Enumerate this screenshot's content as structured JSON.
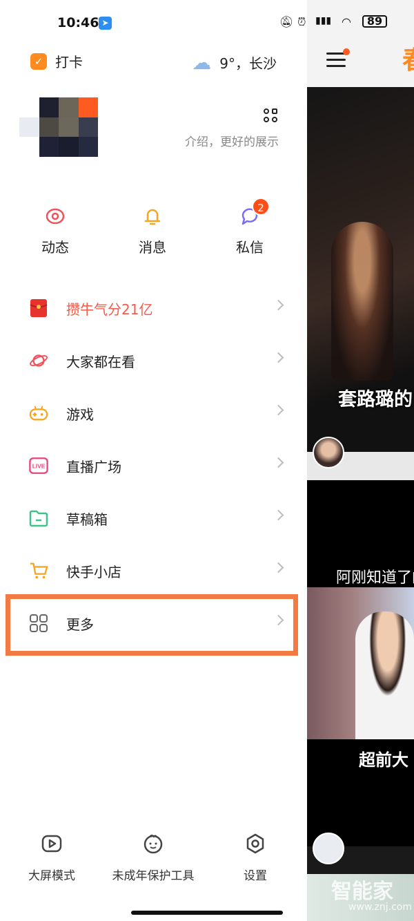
{
  "status_bar": {
    "time": "10:46",
    "battery": "89"
  },
  "drawer": {
    "checkin_label": "打卡",
    "weather": {
      "text": "9°，长沙"
    },
    "profile": {
      "bio_text": "介绍，更好的展示"
    },
    "quick_actions": [
      {
        "label": "动态",
        "icon": "eye-icon",
        "badge": ""
      },
      {
        "label": "消息",
        "icon": "bell-icon",
        "badge": ""
      },
      {
        "label": "私信",
        "icon": "chat-bubble-icon",
        "badge": "2"
      }
    ],
    "menu": [
      {
        "label": "攒牛气分21亿",
        "icon": "red-envelope-icon",
        "highlight_text": true
      },
      {
        "label": "大家都在看",
        "icon": "planet-icon"
      },
      {
        "label": "游戏",
        "icon": "gamepad-icon"
      },
      {
        "label": "直播广场",
        "icon": "live-icon",
        "icon_text": "LIVE"
      },
      {
        "label": "草稿箱",
        "icon": "folder-icon"
      },
      {
        "label": "快手小店",
        "icon": "cart-icon"
      },
      {
        "label": "更多",
        "icon": "grid-icon",
        "outlined": true
      }
    ],
    "bottom_actions": [
      {
        "label": "大屏模式",
        "icon": "play-icon"
      },
      {
        "label": "未成年保护工具",
        "icon": "child-face-icon"
      },
      {
        "label": "设置",
        "icon": "settings-icon"
      }
    ]
  },
  "feed": {
    "card1_caption": "套路璐的",
    "card2_caption_top": "阿刚知道了的",
    "card2_caption_bottom": "超前大",
    "watermark": "智能家",
    "watermark_url": "www.znj.com"
  },
  "colors": {
    "accent_orange": "#ff8a1f",
    "highlight_border": "#f47a43",
    "badge_red": "#ff4d1a",
    "hot_text": "#f25a4a"
  }
}
